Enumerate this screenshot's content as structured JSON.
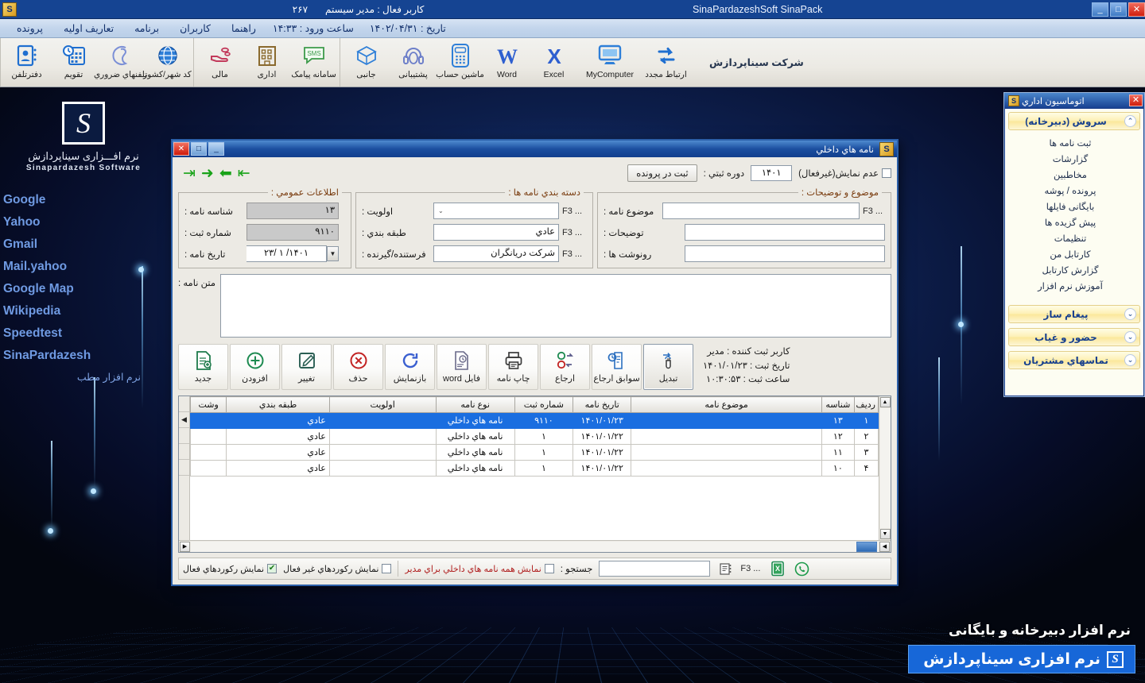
{
  "app": {
    "title": "SinaPardazeshSoft SinaPack",
    "active_user": "کاربر فعال : مدیر سیستم",
    "user_count": "۲۶۷",
    "minimize": "_",
    "maximize": "□",
    "close": "✕",
    "company_name": "شرکت سیناپردازش"
  },
  "menubar": {
    "items": [
      {
        "label": "پرونده"
      },
      {
        "label": "تعاریف اولیه"
      },
      {
        "label": "برنامه"
      },
      {
        "label": "کاربران"
      },
      {
        "label": "راهنما"
      }
    ],
    "login_time": "ساعت ورود : ۱۴:۳۳",
    "date": "تاریخ : ۱۴۰۲/۰۴/۳۱"
  },
  "toolbar": {
    "group_left": [
      {
        "label": "ارتباط مجدد",
        "icon": "reconnect-icon"
      },
      {
        "label": "MyComputer",
        "icon": "monitor-icon"
      },
      {
        "label": "Excel",
        "icon": "excel-icon"
      },
      {
        "label": "Word",
        "icon": "word-icon"
      },
      {
        "label": "ماشین حساب",
        "icon": "calculator-icon"
      },
      {
        "label": "پشتیبانی",
        "icon": "headset-icon"
      },
      {
        "label": "جانبی",
        "icon": "box-icon"
      }
    ],
    "group_mid": [
      {
        "label": "سامانه پیامک",
        "icon": "sms-icon"
      },
      {
        "label": "اداری",
        "icon": "building-icon"
      },
      {
        "label": "مالی",
        "icon": "finance-hand-icon"
      }
    ],
    "group_right": [
      {
        "label": "کد شهر/کشور",
        "icon": "globe-icon"
      },
      {
        "label": "تلفنهاي ضروري",
        "icon": "phone-icon"
      },
      {
        "label": "تقویم",
        "icon": "calendar-icon"
      },
      {
        "label": "دفترتلفن",
        "icon": "contacts-icon"
      }
    ]
  },
  "left_panel": {
    "brand_glyph": "S",
    "brand_fa": "نرم افـــزاری سیناپردازش",
    "brand_en": "Sinapardazesh Software",
    "links": [
      {
        "label": "Google",
        "rtl": false
      },
      {
        "label": "Yahoo",
        "rtl": false
      },
      {
        "label": "Gmail",
        "rtl": false
      },
      {
        "label": "Mail.yahoo",
        "rtl": false
      },
      {
        "label": "Google Map",
        "rtl": false
      },
      {
        "label": "Wikipedia",
        "rtl": false
      },
      {
        "label": "Speedtest",
        "rtl": false
      },
      {
        "label": "SinaPardazesh",
        "rtl": false
      },
      {
        "label": "نرم افزار مطب",
        "rtl": true
      }
    ]
  },
  "right_panel": {
    "title": "اتوماسیون اداري",
    "close": "✕",
    "sections": [
      {
        "title": "سروش (دبیرخانه)",
        "chevron": "⌃",
        "expanded": true,
        "items": [
          "ثبت نامه ها",
          "گزارشات",
          "مخاطبین",
          "پرونده / پوشه",
          "بایگانی فایلها",
          "پیش گزیده ها",
          "تنظیمات",
          "کارتابل من",
          "گزارش کارتابل",
          "آموزش نرم افزار"
        ]
      },
      {
        "title": "پیغام ساز",
        "chevron": "⌄",
        "expanded": false,
        "items": []
      },
      {
        "title": "حضور و غیاب",
        "chevron": "⌄",
        "expanded": false,
        "items": []
      },
      {
        "title": "تماسهاي مشتریان",
        "chevron": "⌄",
        "expanded": false,
        "items": []
      }
    ]
  },
  "letters_window": {
    "title": "نامه هاي داخلي",
    "minimize": "_",
    "maximize": "□",
    "close": "✕",
    "toprow": {
      "hide_checkbox_label": "عدم نمایش(غیرفعال)",
      "hide_checkbox_checked": false,
      "period_label": "دوره ثبتي :",
      "period_value": "۱۴۰۱",
      "register_button": "ثبت در پرونده",
      "nav": [
        "⇥",
        "➜",
        "⬅",
        "⇤"
      ]
    },
    "group_general": {
      "legend": "اطلاعات عمومي :",
      "rows": [
        {
          "label": "شناسه نامه :",
          "value": "۱۳",
          "readonly": true,
          "hint": ""
        },
        {
          "label": "شماره ثبت :",
          "value": "۹۱۱۰",
          "readonly": true,
          "hint": ""
        },
        {
          "label": "تاریخ نامه :",
          "value": "۱۴۰۱/ ۱ /۲۳",
          "readonly": false,
          "hint": "",
          "combo": true
        }
      ]
    },
    "group_category": {
      "legend": "دسته بندي نامه ها :",
      "rows": [
        {
          "label": "اولویت :",
          "value": "",
          "hint": "F3 ...",
          "combo_inline": true
        },
        {
          "label": "طبقه بندي :",
          "value": "عادي",
          "hint": "F3 ..."
        },
        {
          "label": "فرستنده/گیرنده :",
          "value": "شرکت دریانگران",
          "hint": "F3 ..."
        }
      ]
    },
    "group_subject": {
      "legend": "موضوع و توضیحات :",
      "rows": [
        {
          "label": "موضوع نامه :",
          "value": "",
          "hint": "F3 ..."
        },
        {
          "label": "توضیحات :",
          "value": "",
          "hint": ""
        },
        {
          "label": "رونوشت ها :",
          "value": "",
          "hint": ""
        }
      ]
    },
    "body": {
      "label": "متن نامه :",
      "value": ""
    },
    "reg_info": [
      "کاربر ثبت کننده : مدیر",
      "تاریخ ثبت : ۱۴۰۱/۰۱/۲۳",
      "ساعت ثبت : ۱۰:۳۰:۵۳"
    ],
    "buttons": [
      {
        "label": "جدید",
        "icon": "new-doc-icon",
        "active": false
      },
      {
        "label": "افزودن",
        "icon": "plus-circle-icon",
        "active": false
      },
      {
        "label": "تغییر",
        "icon": "edit-pencil-icon",
        "active": false
      },
      {
        "label": "حذف",
        "icon": "delete-x-icon",
        "active": false
      },
      {
        "label": "بازنمایش",
        "icon": "refresh-icon",
        "active": false
      },
      {
        "label": "فایل word",
        "icon": "word-file-icon",
        "active": false
      },
      {
        "label": "چاپ نامه",
        "icon": "printer-icon",
        "active": false
      },
      {
        "label": "ارجاع",
        "icon": "referral-icon",
        "active": false
      },
      {
        "label": "سوابق ارجاع",
        "icon": "referral-history-icon",
        "active": false
      },
      {
        "label": "تبدیل",
        "icon": "convert-icon",
        "active": true
      }
    ],
    "grid": {
      "columns": [
        "ردیف",
        "شناسه",
        "موضوع نامه",
        "تاریخ نامه",
        "شماره ثبت",
        "نوع نامه",
        "اولویت",
        "طبقه بندي",
        "وشت"
      ],
      "rows": [
        {
          "cells": [
            "۱",
            "۱۳",
            "",
            "۱۴۰۱/۰۱/۲۳",
            "۹۱۱۰",
            "نامه هاي داخلي",
            "",
            "عادي",
            ""
          ],
          "selected": true
        },
        {
          "cells": [
            "۲",
            "۱۲",
            "",
            "۱۴۰۱/۰۱/۲۲",
            "۱",
            "نامه هاي داخلي",
            "",
            "عادي",
            ""
          ],
          "selected": false
        },
        {
          "cells": [
            "۳",
            "۱۱",
            "",
            "۱۴۰۱/۰۱/۲۲",
            "۱",
            "نامه هاي داخلي",
            "",
            "عادي",
            ""
          ],
          "selected": false
        },
        {
          "cells": [
            "۴",
            "۱۰",
            "",
            "۱۴۰۱/۰۱/۲۲",
            "۱",
            "نامه هاي داخلي",
            "",
            "عادي",
            ""
          ],
          "selected": false
        }
      ]
    },
    "footer": {
      "show_active_label": "نمایش رکوردهاي فعال",
      "show_active_checked": true,
      "show_inactive_label": "نمایش رکوردهاي غیر فعال",
      "show_inactive_checked": false,
      "show_all_label": "نمایش همه نامه هاي داخلي براي مدیر",
      "show_all_checked": false,
      "search_label": "جستجو :",
      "search_value": "",
      "search_hint": "F3 ...",
      "excel_icon": "excel-export-icon",
      "whatsapp_icon": "whatsapp-icon"
    }
  },
  "product_badges": {
    "line1": "نرم افزار دبیرخانه و بایگانی",
    "line2": "نرم افزاری سیناپردازش",
    "badge_glyph": "S"
  }
}
